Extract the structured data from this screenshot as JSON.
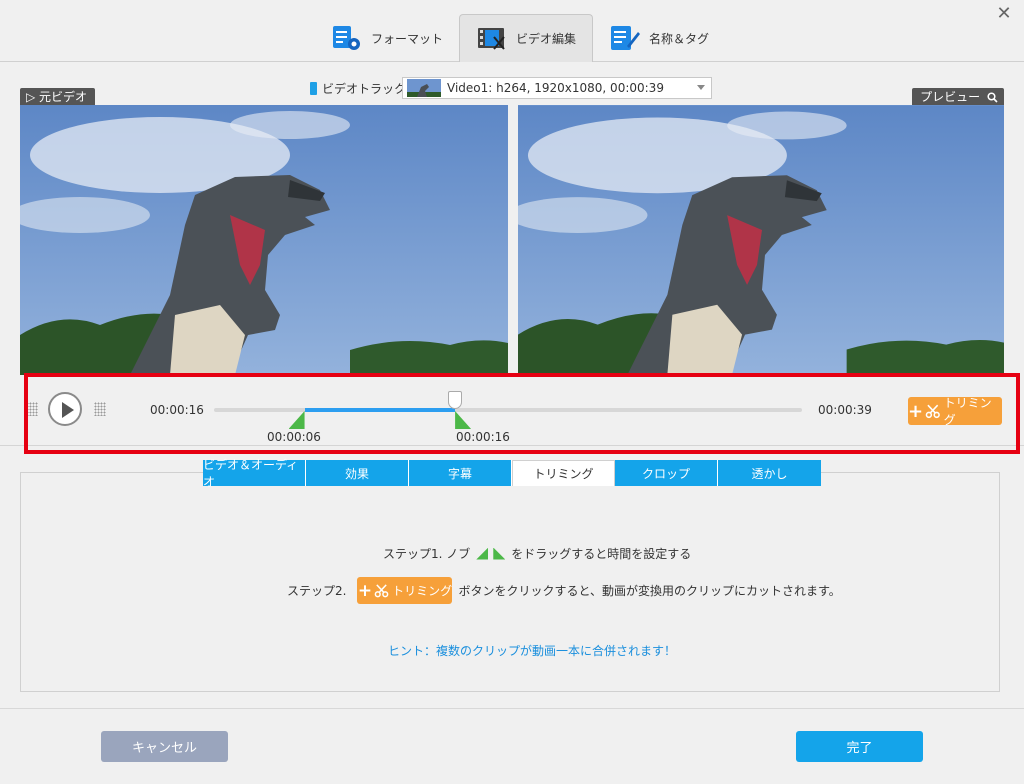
{
  "window": {
    "close_glyph": "✕"
  },
  "tabs": [
    {
      "label": "フォーマット",
      "icon": "format-settings-icon"
    },
    {
      "label": "ビデオ編集",
      "icon": "video-edit-icon",
      "active": true
    },
    {
      "label": "名称＆タグ",
      "icon": "rename-tag-icon"
    }
  ],
  "preview": {
    "original_label": "▷ 元ビデオ",
    "preview_label": "プレビュー",
    "track_label": "ビデオトラック:",
    "track_value": "Video1: h264, 1920x1080, 00:00:39"
  },
  "player": {
    "current_time": "00:00:16",
    "total_time": "00:00:39",
    "start_mark_time": "00:00:06",
    "end_mark_time": "00:00:16",
    "trim_button_label": "トリミング",
    "start_fraction": 0.154,
    "end_fraction": 0.41,
    "playhead_fraction": 0.41
  },
  "subtabs": [
    {
      "label": "ビデオ＆オーディオ"
    },
    {
      "label": "効果"
    },
    {
      "label": "字幕"
    },
    {
      "label": "トリミング",
      "active": true
    },
    {
      "label": "クロップ"
    },
    {
      "label": "透かし"
    }
  ],
  "instructions": {
    "step1_prefix": "ステップ1. ノブ",
    "step1_suffix": "をドラッグすると時間を設定する",
    "step2_prefix": "ステップ2.",
    "step2_button": "トリミング",
    "step2_suffix": "ボタンをクリックすると、動画が変換用のクリップにカットされます。",
    "hint": "ヒント：複数のクリップが動画一本に合併されます！"
  },
  "footer": {
    "cancel_label": "キャンセル",
    "done_label": "完了"
  },
  "colors": {
    "accent_blue": "#14a4ea",
    "trim_orange": "#f6a03a",
    "marker_green": "#4cb848",
    "highlight_red": "#e60012"
  }
}
